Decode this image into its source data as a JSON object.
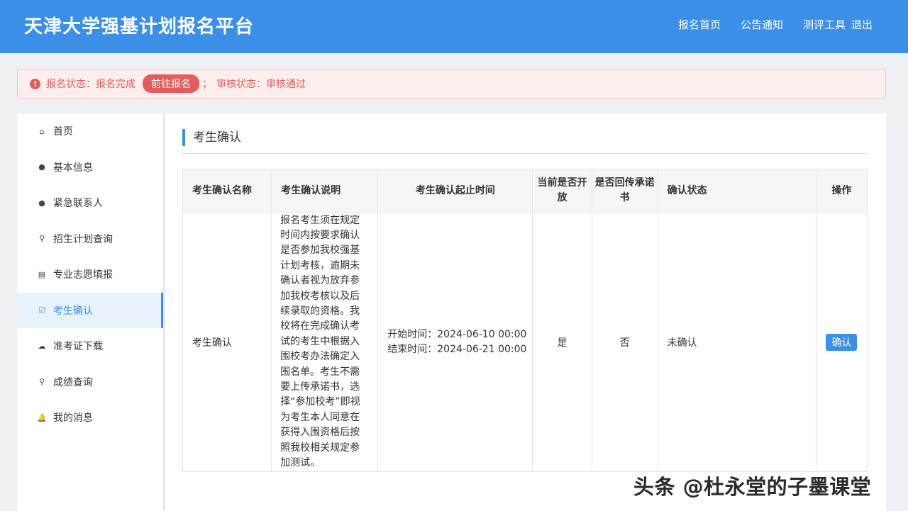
{
  "header": {
    "title": "天津大学强基计划报名平台",
    "nav": [
      "报名首页",
      "公告通知",
      "测评工具",
      "退出"
    ]
  },
  "alert": {
    "icon": "exclamation-icon",
    "status_text": "报名状态：报名完成",
    "button_label": "前往报名",
    "separator": "；",
    "review_text": "审核状态：审核通过"
  },
  "sidebar": {
    "items": [
      {
        "label": "首页",
        "icon": "home-icon",
        "glyph": "⌂"
      },
      {
        "label": "基本信息",
        "icon": "user-icon",
        "glyph": "●"
      },
      {
        "label": "紧急联系人",
        "icon": "user-icon",
        "glyph": "●"
      },
      {
        "label": "招生计划查询",
        "icon": "search-icon",
        "glyph": "⚲"
      },
      {
        "label": "专业志愿填报",
        "icon": "list-icon",
        "glyph": "▤"
      },
      {
        "label": "考生确认",
        "icon": "checkbox-icon",
        "glyph": "☑"
      },
      {
        "label": "准考证下载",
        "icon": "cloud-download-icon",
        "glyph": "☁"
      },
      {
        "label": "成绩查询",
        "icon": "search-icon",
        "glyph": "⚲"
      },
      {
        "label": "我的消息",
        "icon": "bell-icon",
        "glyph": "🔔"
      }
    ],
    "active_index": 5
  },
  "main": {
    "section_title": "考生确认",
    "table": {
      "headers": [
        "考生确认名称",
        "考生确认说明",
        "考生确认起止时间",
        "当前是否开放",
        "是否回传承诺书",
        "确认状态",
        "操作"
      ],
      "row": {
        "name": "考生确认",
        "description": "报名考生须在规定时间内按要求确认是否参加我校强基计划考核，逾期未确认者视为放弃参加我校考核以及后续录取的资格。我校将在完成确认考试的考生中根据入围校考办法确定入围名单。考生不需要上传承诺书，选择“参加校考”即视为考生本人同意在获得入围资格后按照我校相关规定参加测试。",
        "start_time": "开始时间：2024-06-10 00:00",
        "end_time": "结束时间：2024-06-21 00:00",
        "open": "是",
        "pledge": "否",
        "status": "未确认",
        "action_label": "确认"
      }
    }
  },
  "watermark": "头条 @杜永堂的子墨课堂",
  "colors": {
    "primary": "#3b8fe6",
    "alert_red": "#e25c5c",
    "alert_bg": "#fdeeee"
  }
}
